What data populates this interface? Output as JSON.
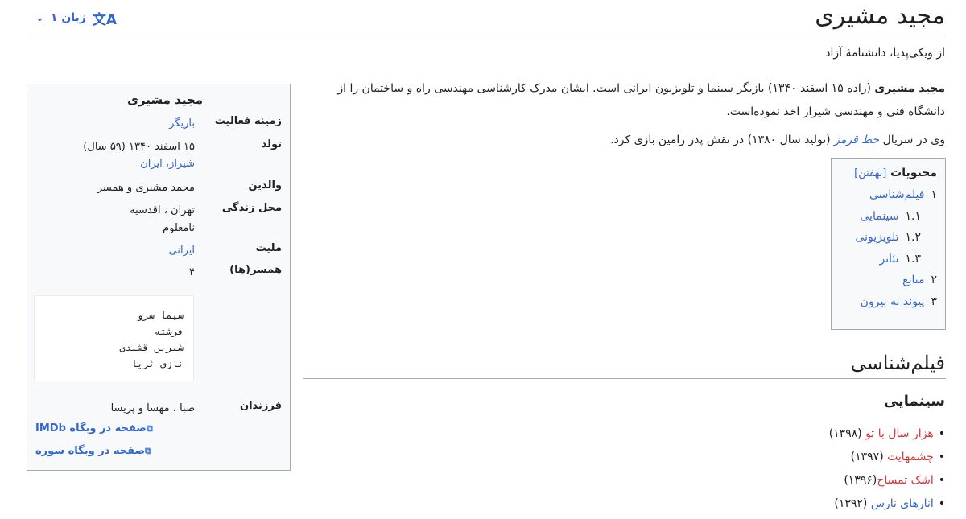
{
  "header": {
    "title": "مجید مشیری",
    "tagline": "از ویکی‌پدیا، دانشنامهٔ آزاد",
    "languages_label": "۱ زبان",
    "language_icon": "translate-icon",
    "chevron_icon": "chevron-down-icon"
  },
  "intro": {
    "bold_name": "مجید مشیری",
    "p1_rest": " (زاده ۱۵ اسفند ۱۳۴۰) بازیگر سینما و تلویزیون ایرانی است. ایشان مدرک کارشناسی مهندسی راه و ساختمان را از دانشگاه فنی و مهندسی شیراز اخذ نموده‌است.",
    "p2_before": "وی در سریال ",
    "p2_link": "خط قرمز",
    "p2_after": " (تولید سال ۱۳۸۰) در نقش پدر رامین بازی کرد."
  },
  "toc": {
    "title": "محتویات",
    "hide_label": "[نهفتن]",
    "items": [
      {
        "num": "۱",
        "label": "فیلم‌شناسی"
      },
      {
        "num": "۱.۱",
        "label": "سینمایی"
      },
      {
        "num": "۱.۲",
        "label": "تلویزیونی"
      },
      {
        "num": "۱.۳",
        "label": "تئاتر"
      },
      {
        "num": "۲",
        "label": "منابع"
      },
      {
        "num": "۳",
        "label": "پیوند به بیرون"
      }
    ]
  },
  "sections": {
    "filmography": "فیلم‌شناسی",
    "cinema": "سینمایی",
    "films": [
      {
        "title": "هزار سال با تو",
        "year": " (۱۳۹۸)"
      },
      {
        "title": "چشمهایت",
        "year": " (۱۳۹۷)"
      },
      {
        "title": "اشک تمساح",
        "year": "(۱۳۹۶)"
      },
      {
        "title": "انارهای نارس",
        "year": " (۱۳۹۲)"
      }
    ],
    "film_link_colors": [
      "#d73333",
      "#d73333",
      "#d73333",
      "#3366cc"
    ]
  },
  "infobox": {
    "name": "مجید مشیری",
    "field_label": "زمینه فعالیت",
    "field_value": "بازیگر",
    "born_label": "تولد",
    "born_value": "۱۵ اسفند ۱۳۴۰ (۵۹ سال)",
    "born_place": "شیراز، ایران",
    "parents_label": "والدین",
    "parents_value": "محمد مشیری و همسر",
    "residence_label": "محل زندگی",
    "residence_value_1": "تهران ، اقدسیه",
    "residence_value_2": "نامعلوم",
    "nationality_label": "ملیت",
    "nationality_value": "ایرانی",
    "spouses_label": "همسر(ها)",
    "spouses_value": "۴",
    "spouse_names": [
      "سیما سرو",
      "فرشته",
      "شیرین قشندی",
      "نازی ثریا"
    ],
    "children_label": "فرزندان",
    "children_value": "صبا ، مهسا و پریسا",
    "imdb_link": "صفحه در وبگاه IMDb",
    "soore_link": "صفحه در وبگاه سوره",
    "external_icon": "external-link-icon"
  }
}
